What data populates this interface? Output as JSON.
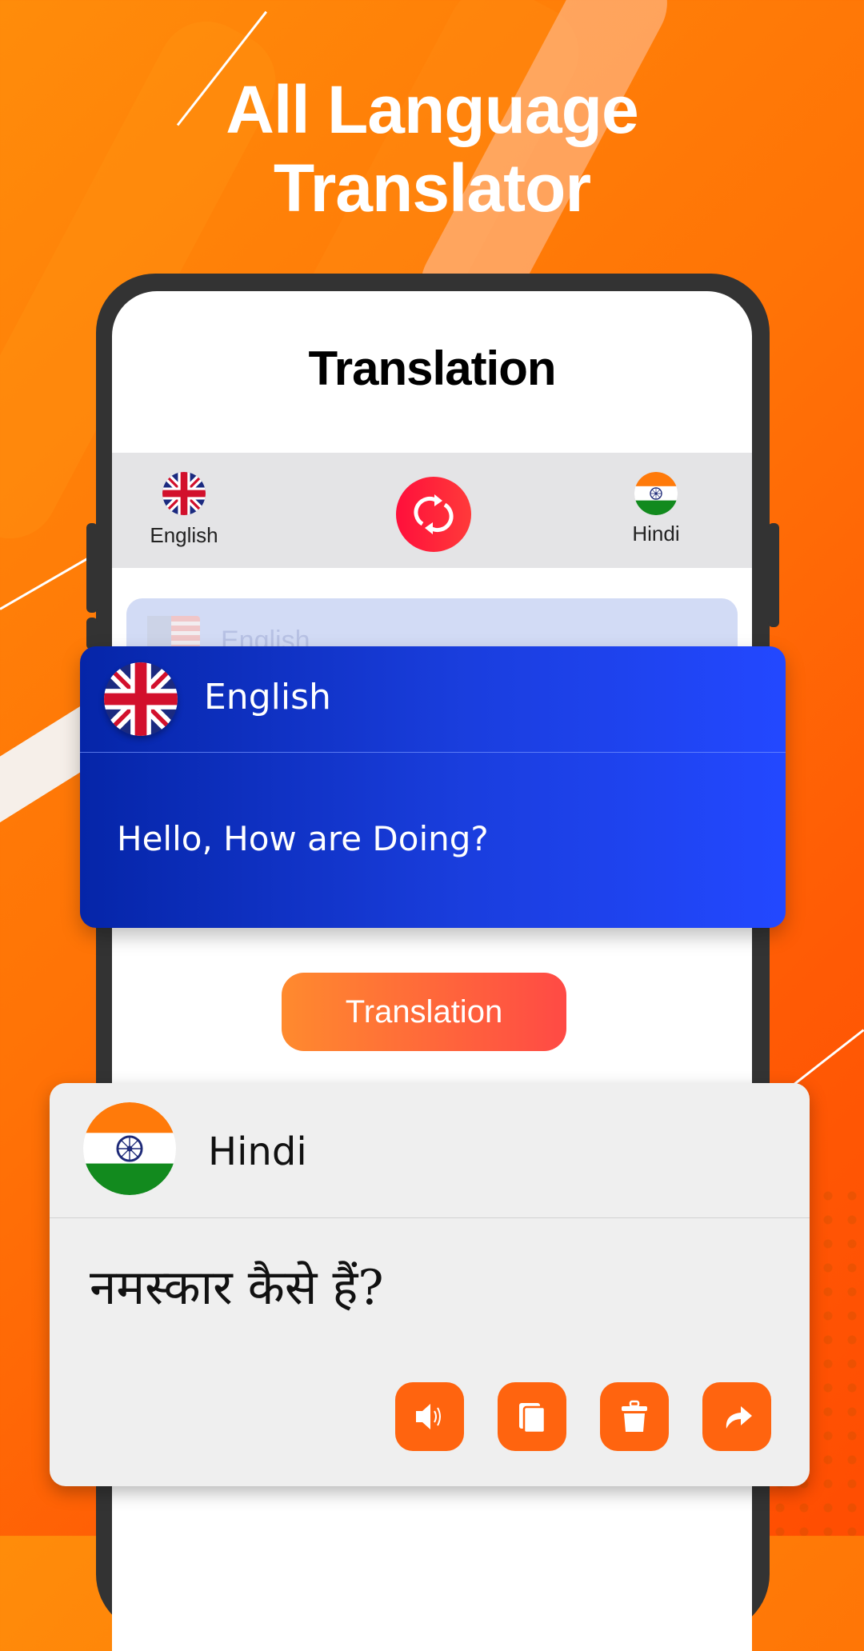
{
  "promo": {
    "headline_line1": "All Language",
    "headline_line2": "Translator"
  },
  "screen": {
    "title": "Translation",
    "source_language": {
      "label": "English",
      "flag": "uk-flag-icon"
    },
    "target_language": {
      "label": "Hindi",
      "flag": "india-flag-icon"
    },
    "swap_icon": "swap-arrows-icon",
    "ghost_input_label": "English",
    "translate_button_label": "Translation"
  },
  "source_card": {
    "language": "English",
    "flag": "uk-flag-icon",
    "text": "Hello, How are Doing?"
  },
  "result_card": {
    "language": "Hindi",
    "flag": "india-flag-icon",
    "text": "नमस्कार कैसे हैं?",
    "actions": [
      {
        "name": "speak",
        "icon": "speaker-icon"
      },
      {
        "name": "copy",
        "icon": "copy-icon"
      },
      {
        "name": "delete",
        "icon": "trash-icon"
      },
      {
        "name": "share",
        "icon": "share-icon"
      }
    ]
  },
  "colors": {
    "brand_orange": "#ff640f",
    "swap_red": "#ff1f3d",
    "card_blue": "#1a3ede",
    "button_gradient_start": "#ff8a2e",
    "button_gradient_end": "#ff4a45"
  }
}
